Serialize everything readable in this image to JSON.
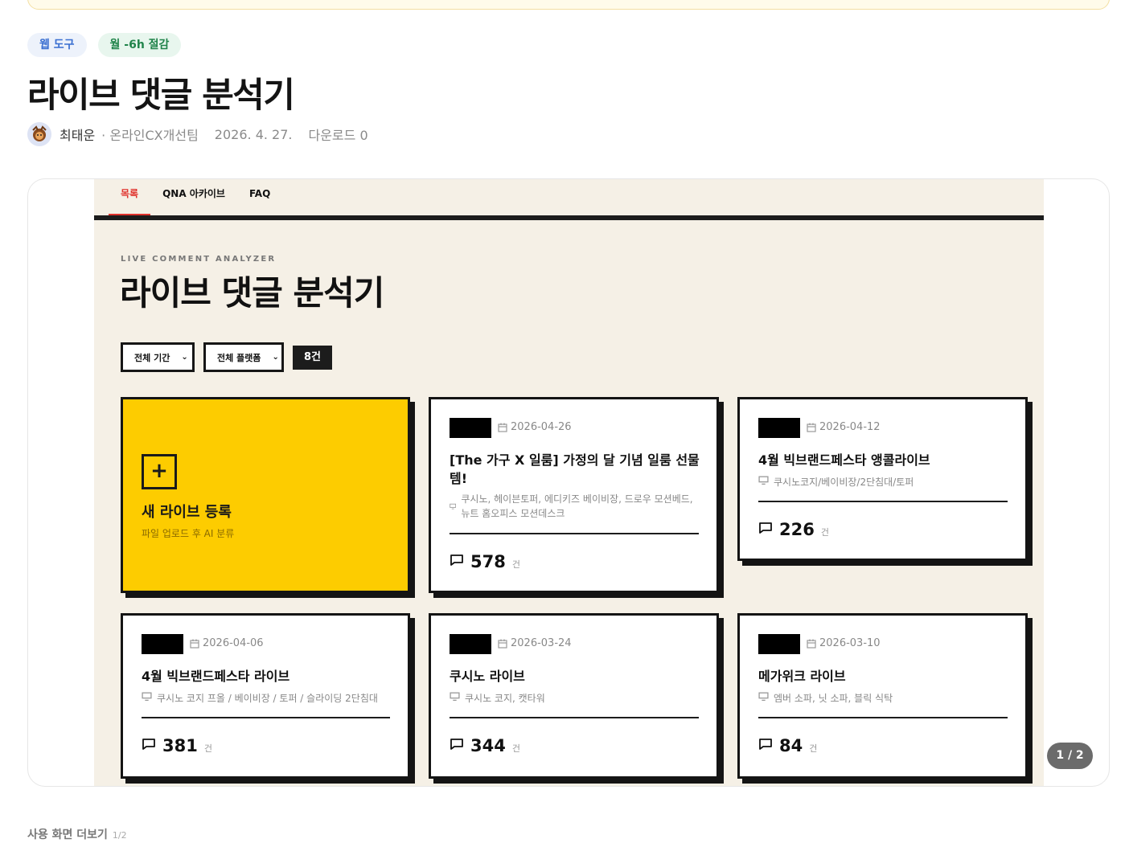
{
  "tags": [
    "웹 도구",
    "월 -6h 절감"
  ],
  "title": "라이브 댓글 분석기",
  "meta": {
    "author": "최태운",
    "team": "· 온라인CX개선팀",
    "date": "2026. 4. 27.",
    "downloads": "다운로드 0"
  },
  "screenshot": {
    "nav_tabs": [
      "목록",
      "QNA 아카이브",
      "FAQ"
    ],
    "active_tab": "목록",
    "kicker": "LIVE COMMENT ANALYZER",
    "title": "라이브 댓글 분석기",
    "filters": {
      "period": "전체 기간",
      "platform": "전체 플랫폼",
      "count": "8건"
    },
    "new_card": {
      "title": "새 라이브 등록",
      "subtitle": "파일 업로드 후 AI 분류"
    },
    "cards": [
      {
        "date": "2026-04-26",
        "title": "[The 가구 X 일룸] 가정의 달 기념 일룸 선물템!",
        "products": "쿠시노, 헤이븐토퍼, 에디키즈 베이비장, 드로우 모션베드, 뉴트 홈오피스 모션데스크",
        "count": "578",
        "unit": "건"
      },
      {
        "date": "2026-04-12",
        "title": "4월 빅브랜드페스타 앵콜라이브",
        "products": "쿠시노코지/베이비장/2단침대/토퍼",
        "count": "226",
        "unit": "건"
      },
      {
        "date": "2026-04-06",
        "title": "4월 빅브랜드페스타 라이브",
        "products": "쿠시노 코지 프올 / 베이비장 / 토퍼 / 슬라이딩 2단침대",
        "count": "381",
        "unit": "건"
      },
      {
        "date": "2026-03-24",
        "title": "쿠시노 라이브",
        "products": "쿠시노 코지, 캣타워",
        "count": "344",
        "unit": "건"
      },
      {
        "date": "2026-03-10",
        "title": "메가위크 라이브",
        "products": "엠버 소파, 닛 소파, 블릭 식탁",
        "count": "84",
        "unit": "건"
      }
    ]
  },
  "pager": "1 / 2",
  "more": {
    "label": "사용 화면 더보기",
    "count": "1/2"
  }
}
